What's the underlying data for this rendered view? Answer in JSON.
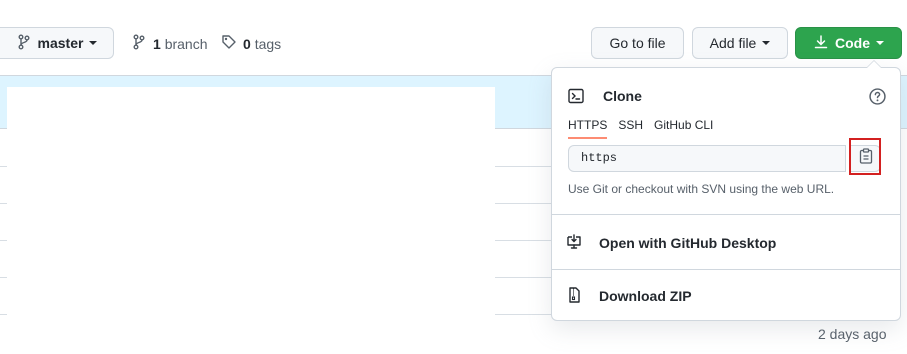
{
  "toolbar": {
    "branch_select": "master",
    "branch_count": "1",
    "branch_label": "branch",
    "tag_count": "0",
    "tag_label": "tags",
    "go_to_file": "Go to file",
    "add_file": "Add file",
    "code_button": "Code"
  },
  "file_list": {
    "last_commit_time": "2 days ago"
  },
  "clone_panel": {
    "title": "Clone",
    "tabs": [
      {
        "label": "HTTPS",
        "active": true
      },
      {
        "label": "SSH",
        "active": false
      },
      {
        "label": "GitHub CLI",
        "active": false
      }
    ],
    "url_value": "https",
    "hint": "Use Git or checkout with SVN using the web URL.",
    "open_desktop": "Open with GitHub Desktop",
    "download_zip": "Download ZIP"
  },
  "colors": {
    "code_button_bg": "#2da44e",
    "highlight_box": "#d32020",
    "active_tab_underline": "#fd8c73",
    "header_band": "#ddf4ff"
  }
}
